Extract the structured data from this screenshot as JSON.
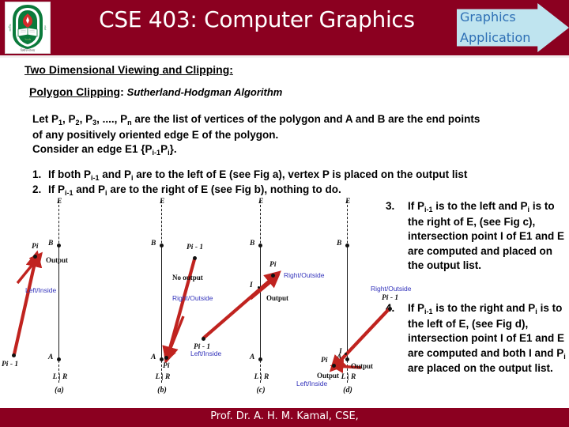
{
  "header": {
    "title": "CSE 403: Computer Graphics",
    "logo_icon": "university-crest-icon",
    "badge": {
      "line1": "Graphics",
      "line2": "Application",
      "fill_color": "#bfe4ef",
      "text_color": "#2d6fb5"
    },
    "bar_color": "#8b0020"
  },
  "content": {
    "heading": "Two Dimensional Viewing and Clipping:",
    "subheading_label": "Polygon Clipping",
    "subheading_colon": ":",
    "subheading_algorithm": "Sutherland-Hodgman Algorithm",
    "paragraph_lines": [
      "Let P1, P2, P3, ...., Pn are the list of vertices of the polygon and A and B are the end points",
      "of any positively oriented edge E of the polygon.",
      "Consider an edge E1 {Pi-1Pi}."
    ],
    "list_items": [
      {
        "number": "1.",
        "text": "If both Pi-1 and Pi are to the left of E (see Fig a), vertex P is placed on the output list"
      },
      {
        "number": "2.",
        "text": "If Pi-1 and Pi are to the right of E (see Fig b), nothing to do."
      },
      {
        "number": "3.",
        "text": "If Pi-1 is to the left and Pi is to the right of E, (see Fig c), intersection point I of E1 and E are computed and placed on the output list."
      },
      {
        "number": "4.",
        "text": "If Pi-1 is to the right and Pi is to the left of E, (see Fig d), intersection point I of E1 and E are computed and both I and Pi are placed on the output list."
      }
    ]
  },
  "figures": [
    {
      "caption": "(a)",
      "edge_label": "E",
      "point_b": "B",
      "point_a": "A",
      "left_right": "L | R",
      "vertex_start": "Pi - 1",
      "vertex_end": "Pi",
      "annotation_black": "Output",
      "annotation_blue": "Left/Inside",
      "arrow_color": "#c0231f"
    },
    {
      "caption": "(b)",
      "edge_label": "E",
      "point_b": "B",
      "point_a": "A",
      "left_right": "L | R",
      "vertex_start": "Pi - 1",
      "vertex_end": "Pi",
      "annotation_black": "No output",
      "annotation_blue": "Right/Outside",
      "arrow_color": "#c0231f"
    },
    {
      "caption": "(c)",
      "edge_label": "E",
      "point_b": "B",
      "point_a": "A",
      "left_right": "L | R",
      "vertex_start": "Pi - 1",
      "vertex_end": "Pi",
      "intersection": "I",
      "annotation_black": "Output",
      "annotation_blue": "Right/Outside",
      "annotation_blue2": "Left/Inside",
      "arrow_color": "#c0231f"
    },
    {
      "caption": "(d)",
      "edge_label": "E",
      "point_b": "B",
      "point_a": "A",
      "left_right": "L | R",
      "vertex_start": "Pi - 1",
      "vertex_end": "Pi",
      "intersection": "I",
      "annotation_black": "Output",
      "annotation_black2": "Output",
      "annotation_blue": "Right/Outside",
      "annotation_blue2": "Left/Inside",
      "arrow_color": "#c0231f"
    }
  ],
  "footer": {
    "text": "Prof. Dr. A. H. M. Kamal, CSE,",
    "bar_color": "#8b0020"
  }
}
